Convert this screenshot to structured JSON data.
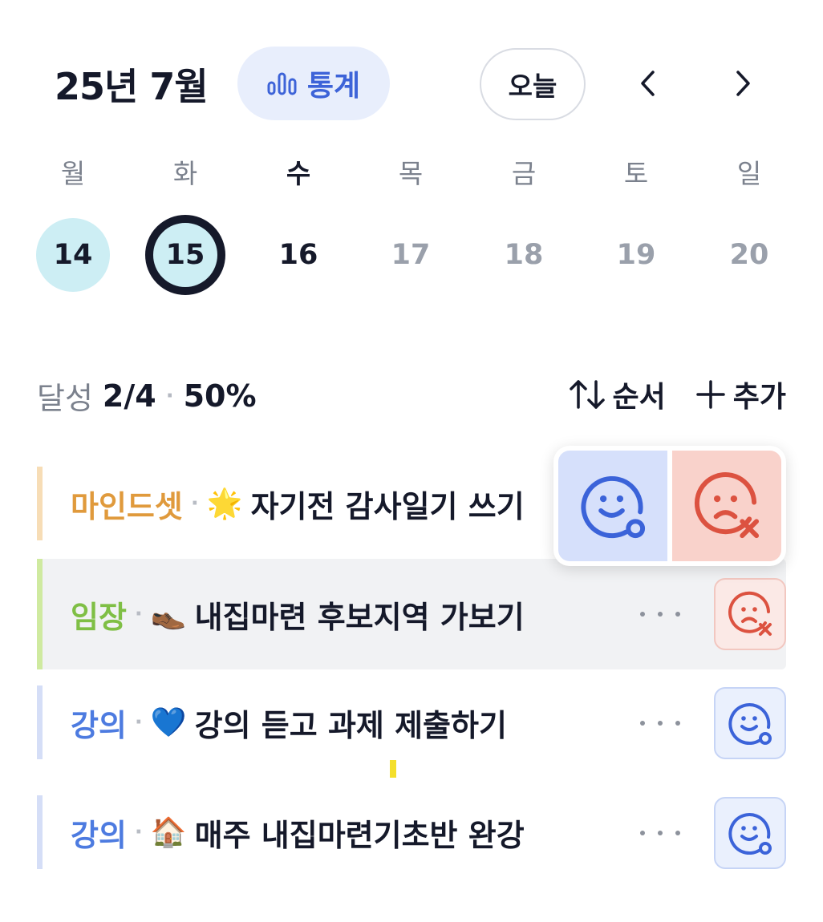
{
  "header": {
    "month_title": "25년 7월",
    "stats_label": "통계",
    "today_label": "오늘"
  },
  "week": {
    "weekdays": [
      "월",
      "화",
      "수",
      "목",
      "금",
      "토",
      "일"
    ],
    "dates": [
      "14",
      "15",
      "16",
      "17",
      "18",
      "19",
      "20"
    ]
  },
  "summary": {
    "label": "달성",
    "count": "2/4",
    "percent": "50%",
    "sort_label": "순서",
    "add_label": "추가"
  },
  "tasks": [
    {
      "category": "마인드셋",
      "emoji": "🌟",
      "title": "자기전 감사일기 쓰기",
      "status": "open"
    },
    {
      "category": "임장",
      "emoji": "👞",
      "title": "내집마련 후보지역 가보기",
      "status": "fail"
    },
    {
      "category": "강의",
      "emoji": "💙",
      "title": "강의 듣고 과제 제출하기",
      "status": "success"
    },
    {
      "category": "강의",
      "emoji": "🏠",
      "title": "매주 내집마련기초반 완강",
      "status": "success"
    }
  ],
  "colors": {
    "mindset": "#e09a3c",
    "mindset_bar": "#f7ddb6",
    "imjang": "#7fbf45",
    "imjang_bar": "#cfeaa0",
    "lecture": "#4d7be0",
    "lecture_bar": "#d5def7",
    "success_icon": "#3b63d9",
    "fail_icon": "#dc5240"
  }
}
